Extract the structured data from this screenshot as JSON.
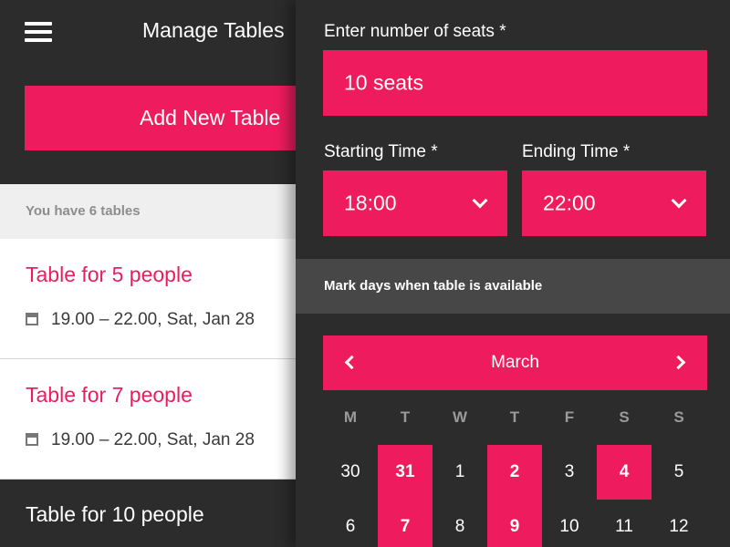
{
  "left_panel": {
    "title": "Manage Tables",
    "add_button": "Add New Table",
    "count_text": "You have 6 tables",
    "tables": [
      {
        "title": "Table for 5 people",
        "meta": "19.00 – 22.00, Sat, Jan 28"
      },
      {
        "title": "Table for 7 people",
        "meta": "19.00 – 22.00, Sat, Jan 28"
      },
      {
        "title": "Table for 10 people"
      }
    ]
  },
  "form": {
    "seats_label": "Enter number of seats *",
    "seats_value": "10 seats",
    "start_label": "Starting Time *",
    "start_value": "18:00",
    "end_label": "Ending Time *",
    "end_value": "22:00",
    "availability_label": "Mark days when table is available"
  },
  "calendar": {
    "month": "March",
    "weekdays": [
      "M",
      "T",
      "W",
      "T",
      "F",
      "S",
      "S"
    ],
    "rows": [
      [
        {
          "d": "30",
          "sel": false
        },
        {
          "d": "31",
          "sel": true
        },
        {
          "d": "1",
          "sel": false
        },
        {
          "d": "2",
          "sel": true
        },
        {
          "d": "3",
          "sel": false
        },
        {
          "d": "4",
          "sel": true
        },
        {
          "d": "5",
          "sel": false
        }
      ],
      [
        {
          "d": "6",
          "sel": false
        },
        {
          "d": "7",
          "sel": true
        },
        {
          "d": "8",
          "sel": false
        },
        {
          "d": "9",
          "sel": true
        },
        {
          "d": "10",
          "sel": false
        },
        {
          "d": "11",
          "sel": false
        },
        {
          "d": "12",
          "sel": false
        }
      ]
    ]
  },
  "colors": {
    "accent": "#ee1c5e",
    "background": "#2c2c2c",
    "muted_bar": "#474747"
  },
  "icons": [
    "menu-icon",
    "calendar-icon",
    "chevron-down-icon",
    "chevron-left-icon",
    "chevron-right-icon"
  ]
}
